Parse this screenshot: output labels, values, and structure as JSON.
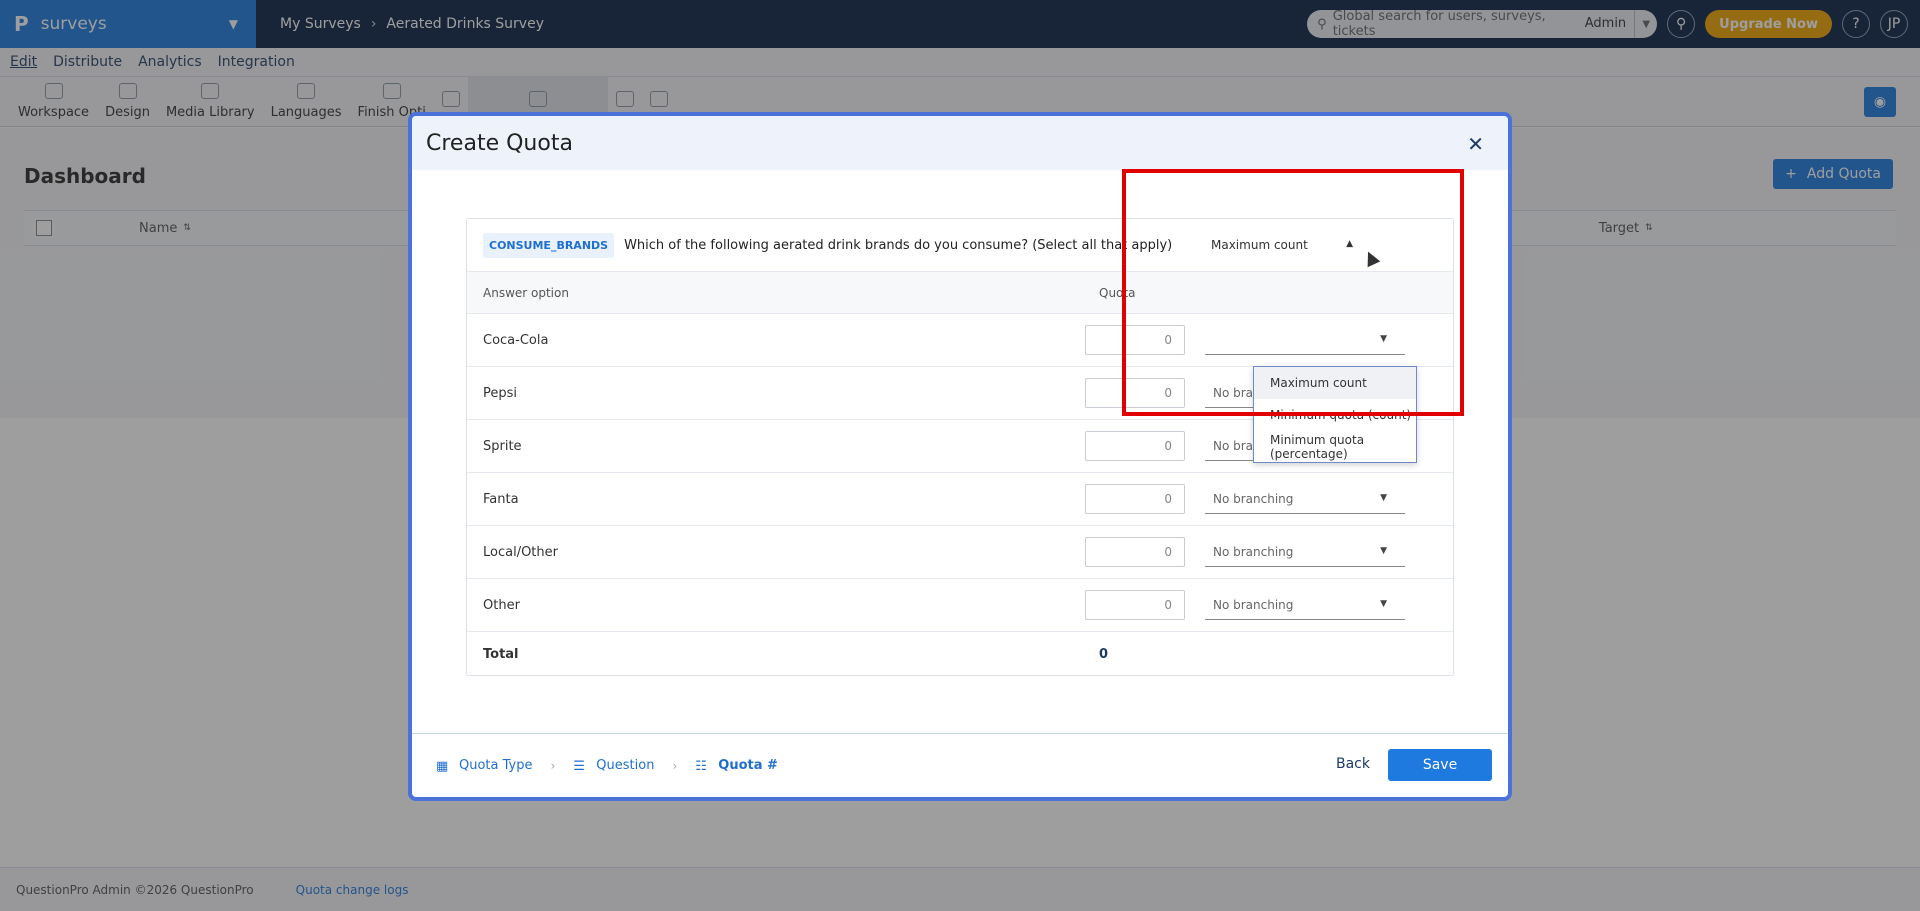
{
  "brand": {
    "logo": "P",
    "name": "surveys"
  },
  "breadcrumb": [
    "My Surveys",
    "Aerated Drinks Survey"
  ],
  "global_search": {
    "placeholder": "Global search for users, surveys, tickets",
    "role": "Admin"
  },
  "upgrade_label": "Upgrade Now",
  "help_label": "?",
  "user_initials": "JP",
  "menu": [
    "Edit",
    "Distribute",
    "Analytics",
    "Integration"
  ],
  "toolbar": [
    "Workspace",
    "Design",
    "Media Library",
    "Languages",
    "Finish Opti"
  ],
  "dashboard": {
    "title": "Dashboard",
    "add_quota_label": "Add Quota",
    "columns": {
      "name": "Name",
      "target": "Target"
    }
  },
  "footer": {
    "copyright": "QuestionPro Admin ©2026 QuestionPro",
    "link": "Quota change logs"
  },
  "modal": {
    "title": "Create Quota",
    "question_code": "CONSUME_BRANDS",
    "question_text": "Which of the following aerated drink brands do you consume? (Select all that apply)",
    "quota_mode": "Maximum count",
    "mode_options": [
      "Maximum count",
      "Minimum quota (count)",
      "Minimum quota (percentage)"
    ],
    "col_answer": "Answer option",
    "col_quota": "Quota",
    "rows": [
      {
        "label": "Coca-Cola",
        "quota": "0",
        "branch": ""
      },
      {
        "label": "Pepsi",
        "quota": "0",
        "branch": "No branching"
      },
      {
        "label": "Sprite",
        "quota": "0",
        "branch": "No branching"
      },
      {
        "label": "Fanta",
        "quota": "0",
        "branch": "No branching"
      },
      {
        "label": "Local/Other",
        "quota": "0",
        "branch": "No branching"
      },
      {
        "label": "Other",
        "quota": "0",
        "branch": "No branching"
      }
    ],
    "total_label": "Total",
    "total_value": "0",
    "steps": [
      "Quota Type",
      "Question",
      "Quota #"
    ],
    "back_label": "Back",
    "save_label": "Save"
  },
  "colors": {
    "brand": "#1f7ae0",
    "header": "#0c2244",
    "highlight": "#e00000",
    "upgrade": "#f0a500"
  }
}
